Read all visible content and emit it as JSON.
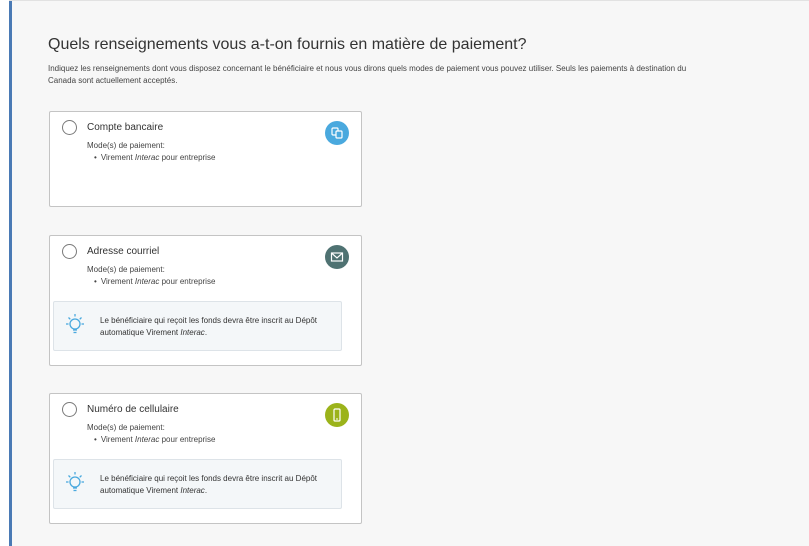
{
  "page": {
    "title": "Quels renseignements vous a-t-on fournis en matière de paiement?",
    "description": "Indiquez les renseignements dont vous disposez concernant le bénéficiaire et nous vous dirons quels modes de paiement vous pouvez utiliser. Seuls les paiements à destination du Canada sont actuellement acceptés."
  },
  "cards": [
    {
      "title": "Compte bancaire",
      "mode_label": "Mode(s) de paiement:",
      "mode_prefix": "Virement ",
      "mode_italic": "Interac",
      "mode_suffix": " pour entreprise",
      "icon": "bank-icon",
      "icon_color": "#4aa9de"
    },
    {
      "title": "Adresse courriel",
      "mode_label": "Mode(s) de paiement:",
      "mode_prefix": "Virement ",
      "mode_italic": "Interac",
      "mode_suffix": " pour entreprise",
      "icon": "envelope-icon",
      "icon_color": "#4f7272",
      "info_prefix": "Le bénéficiaire qui reçoit les fonds devra être inscrit au Dépôt automatique Virement ",
      "info_italic": "Interac",
      "info_suffix": "."
    },
    {
      "title": "Numéro de cellulaire",
      "mode_label": "Mode(s) de paiement:",
      "mode_prefix": "Virement ",
      "mode_italic": "Interac",
      "mode_suffix": " pour entreprise",
      "icon": "mobile-phone-icon",
      "icon_color": "#9bb31a",
      "info_prefix": "Le bénéficiaire qui reçoit les fonds devra être inscrit au Dépôt automatique Virement ",
      "info_italic": "Interac",
      "info_suffix": "."
    }
  ],
  "colors": {
    "left_accent": "#4a7ab5",
    "info_icon": "#4aa9de"
  }
}
